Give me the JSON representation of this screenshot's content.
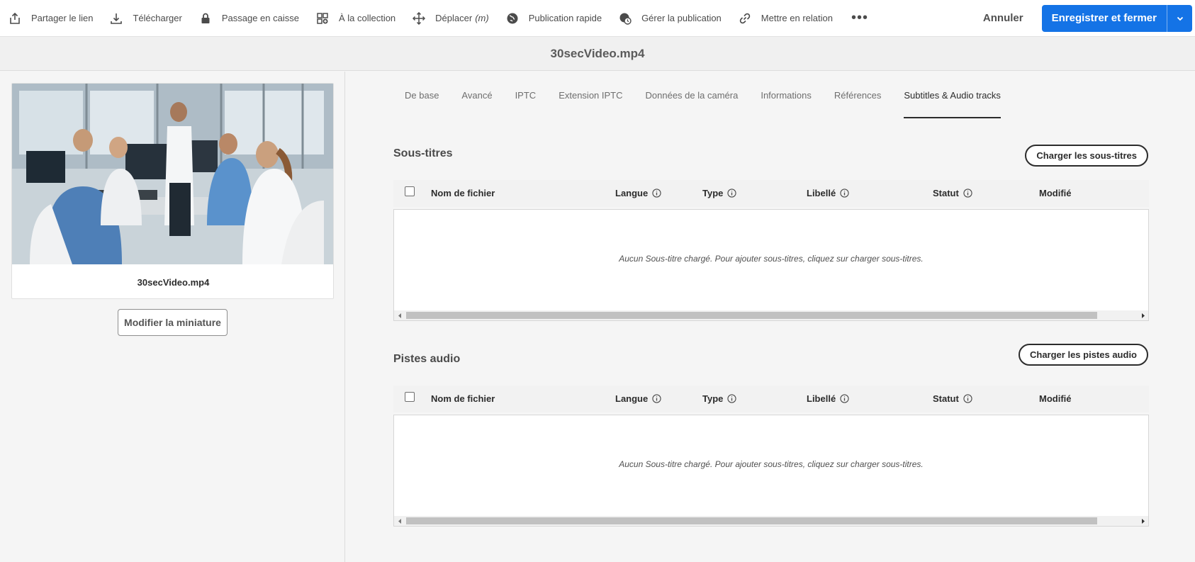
{
  "toolbar": {
    "items": [
      {
        "label": "Partager le lien",
        "icon": "share-icon"
      },
      {
        "label": "Télécharger",
        "icon": "download-icon"
      },
      {
        "label": "Passage en caisse",
        "icon": "lock-icon"
      },
      {
        "label": "À la collection",
        "icon": "collection-add-icon"
      },
      {
        "label": "Déplacer",
        "shortcut": "(m)",
        "icon": "move-icon"
      },
      {
        "label": "Publication rapide",
        "icon": "globe-icon"
      },
      {
        "label": "Gérer la publication",
        "icon": "globe-clock-icon"
      },
      {
        "label": "Mettre en relation",
        "icon": "link-icon"
      }
    ],
    "more": "•••",
    "cancel_label": "Annuler",
    "save_label": "Enregistrer et fermer",
    "accent_color": "#1473e6"
  },
  "title": "30secVideo.mp4",
  "asset": {
    "name": "30secVideo.mp4",
    "edit_thumbnail_label": "Modifier la miniature"
  },
  "tabs": [
    {
      "label": "De base",
      "active": false
    },
    {
      "label": "Avancé",
      "active": false
    },
    {
      "label": "IPTC",
      "active": false
    },
    {
      "label": "Extension IPTC",
      "active": false
    },
    {
      "label": "Données de la caméra",
      "active": false
    },
    {
      "label": "Informations",
      "active": false
    },
    {
      "label": "Références",
      "active": false
    },
    {
      "label": "Subtitles & Audio tracks",
      "active": true
    }
  ],
  "subtitles": {
    "title": "Sous-titres",
    "upload_label": "Charger les sous-titres",
    "columns": [
      "Nom de fichier",
      "Langue",
      "Type",
      "Libellé",
      "Statut",
      "Modifié"
    ],
    "empty_message": "Aucun Sous-titre chargé. Pour ajouter sous-titres, cliquez sur charger sous-titres."
  },
  "audio": {
    "title": "Pistes audio",
    "upload_label": "Charger les pistes audio",
    "columns": [
      "Nom de fichier",
      "Langue",
      "Type",
      "Libellé",
      "Statut",
      "Modifié"
    ],
    "empty_message": "Aucun Sous-titre chargé. Pour ajouter sous-titres, cliquez sur charger sous-titres."
  }
}
